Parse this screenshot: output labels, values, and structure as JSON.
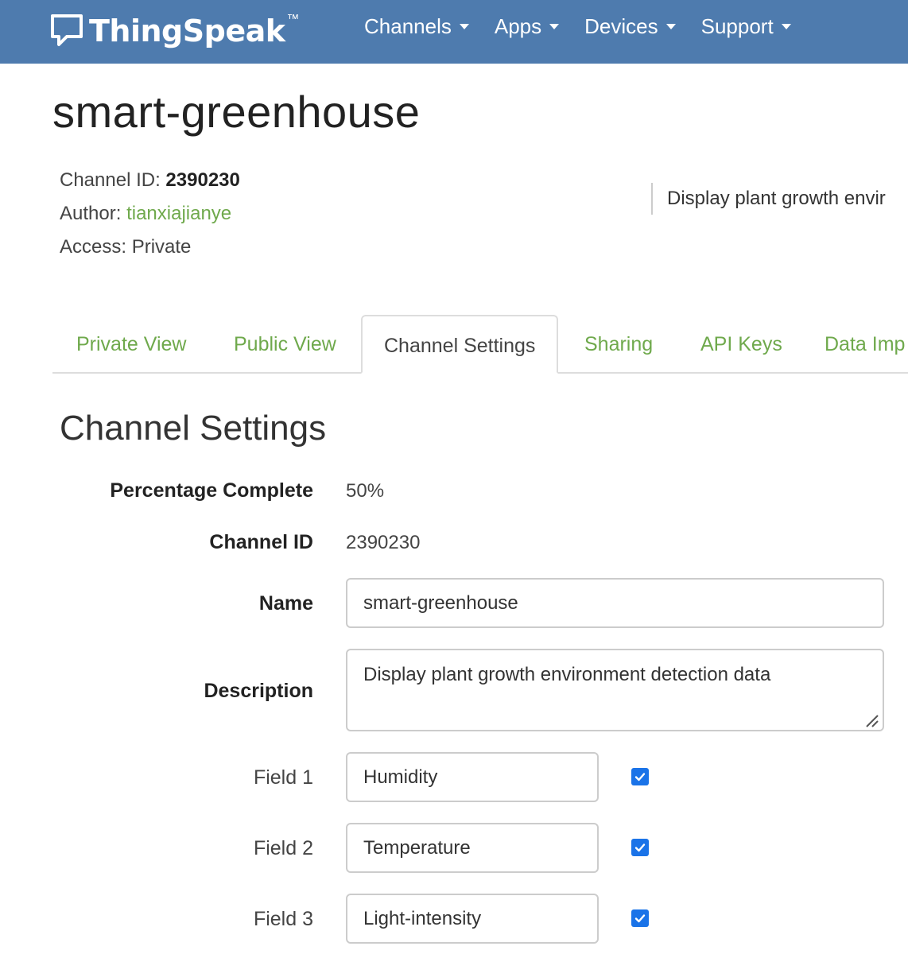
{
  "app": {
    "brand": "ThingSpeak",
    "trademark": "™"
  },
  "nav": {
    "items": [
      {
        "label": "Channels"
      },
      {
        "label": "Apps"
      },
      {
        "label": "Devices"
      },
      {
        "label": "Support"
      }
    ]
  },
  "channel": {
    "title": "smart-greenhouse",
    "id_label": "Channel ID:",
    "id_value": "2390230",
    "author_label": "Author:",
    "author_value": "tianxiajianye",
    "access_label": "Access:",
    "access_value": "Private",
    "description_preview": "Display plant growth envir"
  },
  "tabs": [
    {
      "label": "Private View"
    },
    {
      "label": "Public View"
    },
    {
      "label": "Channel Settings"
    },
    {
      "label": "Sharing"
    },
    {
      "label": "API Keys"
    },
    {
      "label": "Data Imp"
    }
  ],
  "settings": {
    "heading": "Channel Settings",
    "percentage_label": "Percentage Complete",
    "percentage_value": "50%",
    "channel_id_label": "Channel ID",
    "channel_id_value": "2390230",
    "name_label": "Name",
    "name_value": "smart-greenhouse",
    "description_label": "Description",
    "description_value": "Display plant growth environment detection data",
    "fields": [
      {
        "label": "Field 1",
        "value": "Humidity",
        "checked": true
      },
      {
        "label": "Field 2",
        "value": "Temperature",
        "checked": true
      },
      {
        "label": "Field 3",
        "value": "Light-intensity",
        "checked": true
      }
    ]
  },
  "colors": {
    "navbar": "#4e7bae",
    "link_green": "#6fa94c",
    "checkbox_blue": "#1a73e8"
  }
}
